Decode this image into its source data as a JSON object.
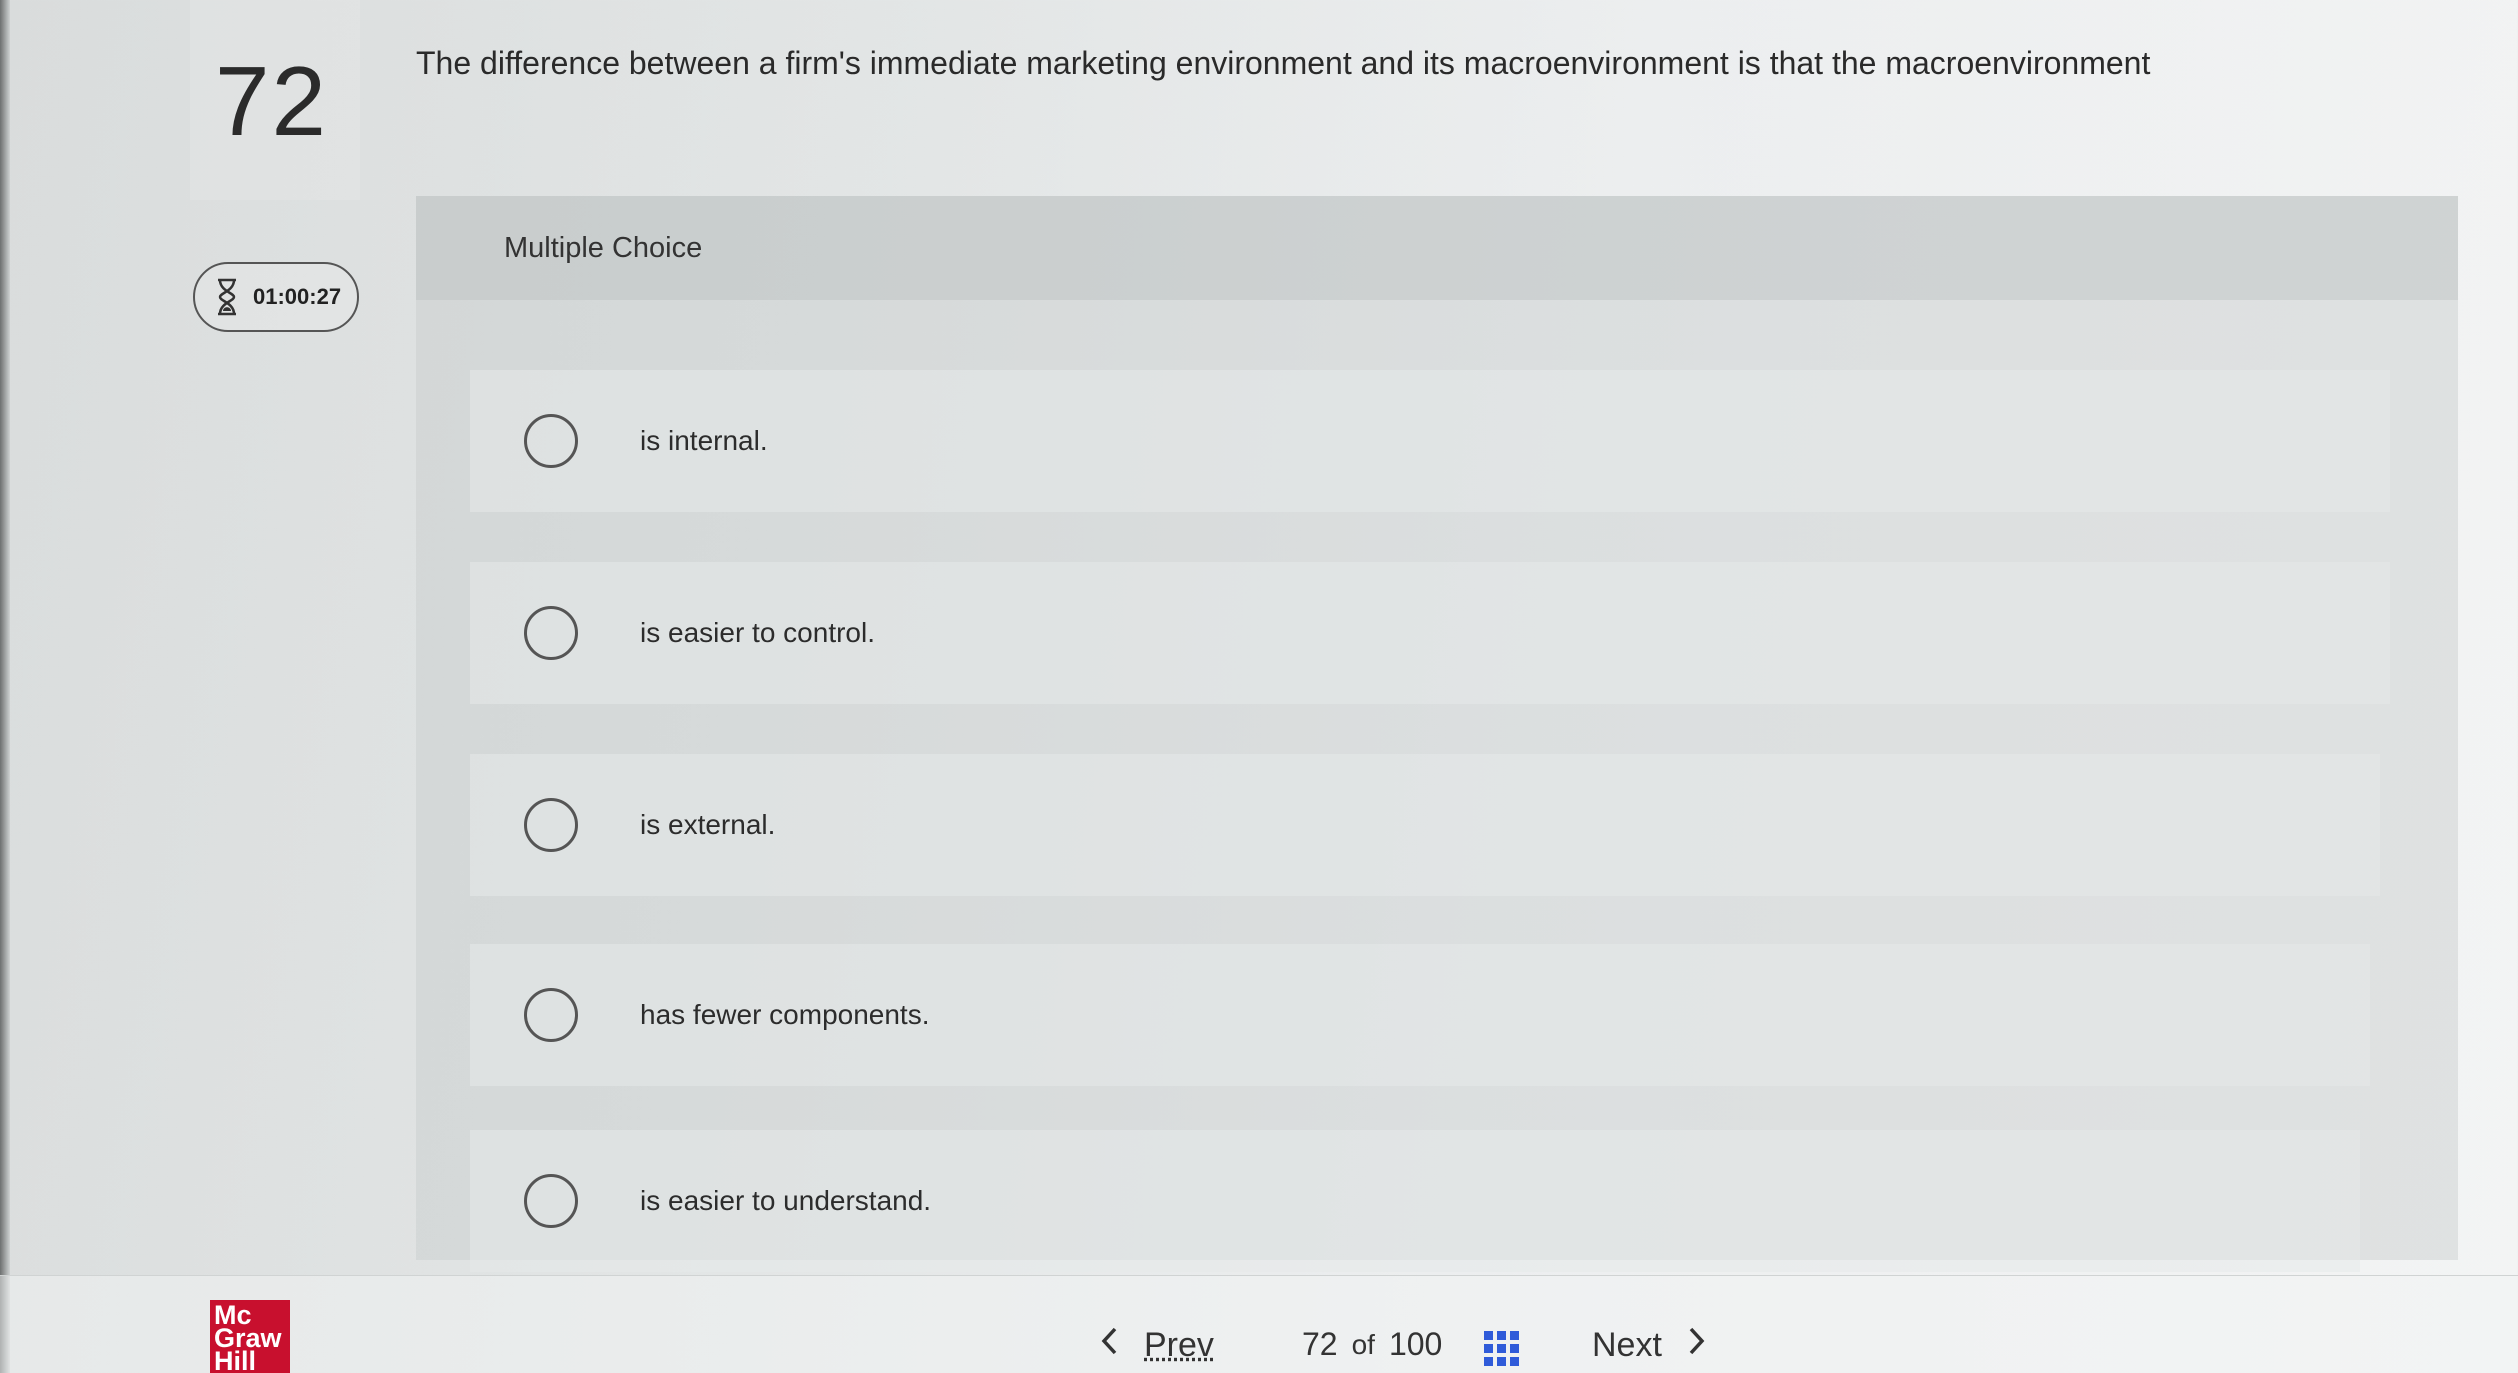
{
  "question": {
    "number": "72",
    "text": "The difference between a firm's immediate marketing environment and its macroenvironment is that the macroenvironment",
    "type": "Multiple Choice"
  },
  "timer": {
    "value": "01:00:27",
    "icon": "hourglass-icon"
  },
  "choices": [
    {
      "label": "is internal."
    },
    {
      "label": "is easier to control."
    },
    {
      "label": "is external."
    },
    {
      "label": "has fewer components."
    },
    {
      "label": "is easier to understand."
    }
  ],
  "footer": {
    "logo_lines": [
      "Mc",
      "Graw",
      "Hill"
    ],
    "prev_label": "Prev",
    "next_label": "Next",
    "current_page": "72",
    "of_label": "of",
    "total_pages": "100"
  },
  "colors": {
    "logo_red": "#c8102e",
    "grid_icon_blue": "#2f5bd9"
  }
}
